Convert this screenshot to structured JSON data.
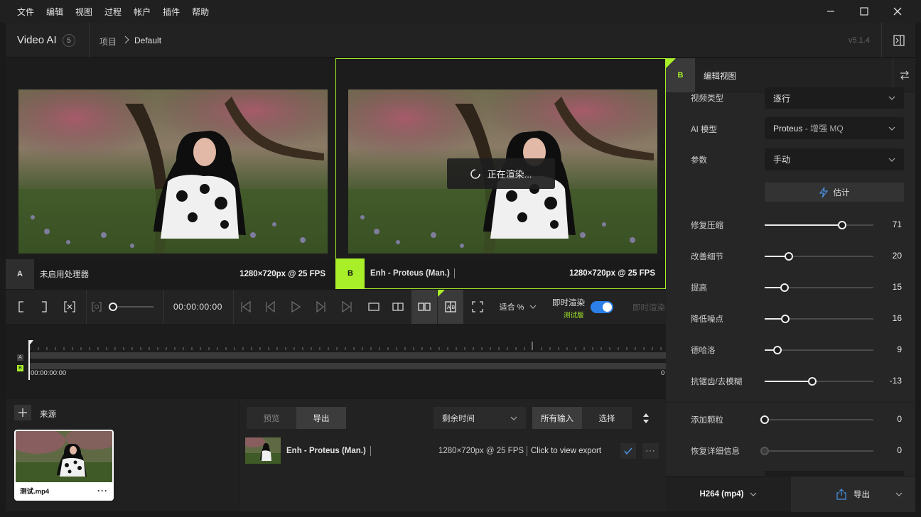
{
  "menu": [
    "文件",
    "编辑",
    "视图",
    "过程",
    "帐户",
    "插件",
    "帮助"
  ],
  "header": {
    "app_title": "Video AI",
    "badge": "5",
    "breadcrumb_root": "项目",
    "breadcrumb_current": "Default",
    "version": "v5.1.4"
  },
  "pane_a": {
    "tag": "A",
    "label": "未启用处理器",
    "resolution": "1280×720px @ 25 FPS"
  },
  "pane_b": {
    "tag": "B",
    "label": "Enh - Proteus (Man.)",
    "resolution": "1280×720px @ 25 FPS",
    "rendering": "正在渲染..."
  },
  "controls": {
    "timecode": "00:00:00:00",
    "zoom_label": "适合 %",
    "realtime_label": "即时渲染",
    "realtime_sub": "测试版",
    "realtime_right": "即时渲染",
    "realtime_on": true
  },
  "timeline": {
    "track_a": "A",
    "track_b": "B",
    "start_time": "00:00:00:00",
    "end_label": "0"
  },
  "sources": {
    "title": "来源",
    "file_name": "测试.mp4"
  },
  "exports": {
    "tab_preview": "预览",
    "tab_export": "导出",
    "sort_label": "剩余时间",
    "filter_all": "所有输入",
    "filter_select": "选择",
    "item_title": "Enh - Proteus (Man.)",
    "item_resolution": "1280×720px @ 25 FPS",
    "item_link": "Click to view export"
  },
  "right_panel": {
    "tag": "B",
    "title": "编辑视图",
    "video_type_label": "视频类型",
    "video_type_value": "逐行",
    "ai_model_label": "AI 模型",
    "ai_model_value": "Proteus",
    "ai_model_suffix": " - 增强 MQ",
    "params_label": "参数",
    "params_value": "手动",
    "estimate_label": "估计",
    "sliders": [
      {
        "label": "修复压缩",
        "value": "71",
        "level": 0.71
      },
      {
        "label": "改善细节",
        "value": "20",
        "level": 0.22
      },
      {
        "label": "提高",
        "value": "15",
        "level": 0.18
      },
      {
        "label": "降低噪点",
        "value": "16",
        "level": 0.19
      },
      {
        "label": "德哈洛",
        "value": "9",
        "level": 0.12
      },
      {
        "label": "抗锯齿/去模糊",
        "value": "-13",
        "level": 0.44
      },
      {
        "label": "添加颗粒",
        "value": "0",
        "level": 0.0
      },
      {
        "label": "恢复详细信息",
        "value": "0",
        "level": 0.0
      }
    ],
    "format_label": "H264 (mp4)",
    "export_label": "导出"
  },
  "colors": {
    "accent": "#a8ef2a",
    "toggle": "#2d7fe8"
  }
}
